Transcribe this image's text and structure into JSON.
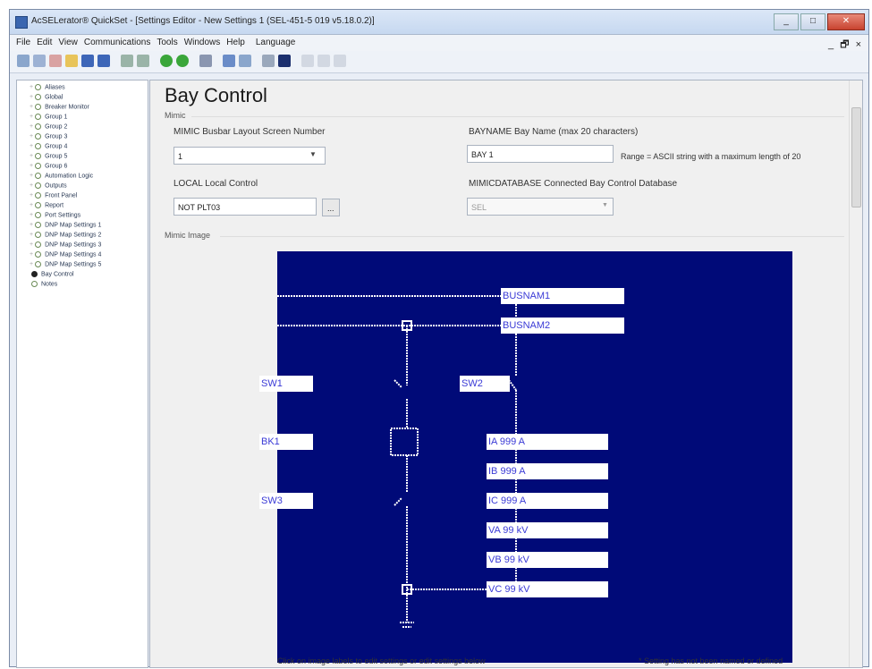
{
  "window": {
    "title": "AcSELerator® QuickSet - [Settings Editor - New Settings 1 (SEL-451-5 019 v5.18.0.2)]",
    "close_label": "✕",
    "minimize_label": "_",
    "maximize_label": "□"
  },
  "menu": {
    "items": [
      "File",
      "Edit",
      "View",
      "Communications",
      "Tools",
      "Windows",
      "Help",
      "Language"
    ],
    "mdi_controls": "_ 🗗 ×"
  },
  "toolbar": {
    "icons": [
      "copy-icon",
      "paste-icon",
      "new-icon",
      "open-icon",
      "save-icon",
      "save-all-icon",
      "import-icon",
      "export-icon",
      "connect-icon",
      "disconnect-icon",
      "read-icon",
      "send-icon",
      "compare-icon",
      "print-icon",
      "view-icon",
      "find-icon",
      "expand-icon",
      "collapse-icon"
    ]
  },
  "tree": {
    "items": [
      {
        "label": "Aliases",
        "selected": false
      },
      {
        "label": "Global",
        "selected": false
      },
      {
        "label": "Breaker Monitor",
        "selected": false
      },
      {
        "label": "Group 1",
        "selected": false
      },
      {
        "label": "Group 2",
        "selected": false
      },
      {
        "label": "Group 3",
        "selected": false
      },
      {
        "label": "Group 4",
        "selected": false
      },
      {
        "label": "Group 5",
        "selected": false
      },
      {
        "label": "Group 6",
        "selected": false
      },
      {
        "label": "Automation Logic",
        "selected": false
      },
      {
        "label": "Outputs",
        "selected": false
      },
      {
        "label": "Front Panel",
        "selected": false
      },
      {
        "label": "Report",
        "selected": false
      },
      {
        "label": "Port Settings",
        "selected": false
      },
      {
        "label": "DNP Map Settings 1",
        "selected": false
      },
      {
        "label": "DNP Map Settings 2",
        "selected": false
      },
      {
        "label": "DNP Map Settings 3",
        "selected": false
      },
      {
        "label": "DNP Map Settings 4",
        "selected": false
      },
      {
        "label": "DNP Map Settings 5",
        "selected": false
      },
      {
        "label": "Bay Control",
        "selected": true
      },
      {
        "label": "Notes",
        "selected": false
      }
    ]
  },
  "editor": {
    "heading": "Bay Control",
    "section_mimic": "Mimic",
    "mimic_screen": {
      "label": "MIMIC Busbar Layout Screen Number",
      "value": "1"
    },
    "bay_name": {
      "label": "BAYNAME Bay Name (max 20 characters)",
      "value": "BAY 1",
      "range": "Range = ASCII string with a maximum length of 20"
    },
    "local_control": {
      "label": "LOCAL Local Control",
      "value": "NOT PLT03",
      "browse_label": "..."
    },
    "mimic_database": {
      "label": "MIMICDATABASE Connected Bay Control Database",
      "value": "SEL"
    },
    "section_mimic_image": "Mimic Image",
    "footer_left": "Click on image labels to edit settings or edit settings below",
    "footer_right": "* Setting has not been named or defined"
  },
  "mimic_labels": {
    "busnam1": "BUSNAM1",
    "busnam2": "BUSNAM2",
    "sw1": "SW1",
    "sw2": "SW2",
    "bk1": "BK1",
    "sw3": "SW3",
    "ia": "IA  999 A",
    "ib": "IB  999 A",
    "ic": "IC  999 A",
    "va": "VA  99 kV",
    "vb": "VB  99 kV",
    "vc": "VC  99 kV"
  },
  "colors": {
    "mimic_background": "#000a78",
    "mimic_line": "#ffffff",
    "label_text": "#3a3ad6"
  }
}
